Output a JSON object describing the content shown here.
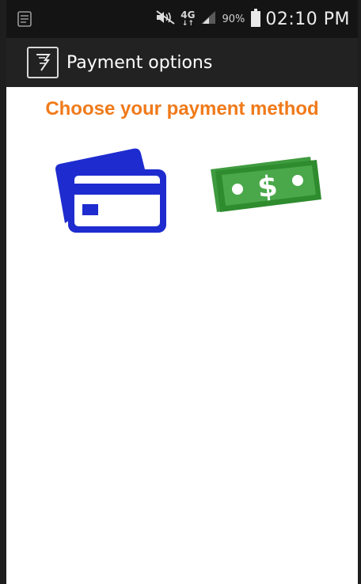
{
  "status_bar": {
    "icons": [
      "notification-icon",
      "mute-icon",
      "network-4g-icon",
      "signal-icon",
      "battery-icon"
    ],
    "network_label_top": "4G",
    "network_label_bottom": "↓↑",
    "battery_percent": "90%",
    "time": "02:10 PM"
  },
  "action_bar": {
    "title": "Payment options",
    "icon": "app-logo-icon"
  },
  "main": {
    "heading": "Choose your payment method",
    "options": [
      {
        "icon": "credit-card-icon",
        "color": "#1e2ccf"
      },
      {
        "icon": "cash-icon",
        "color": "#2e8b2e"
      }
    ]
  },
  "colors": {
    "accent": "#f07a1a",
    "status_bar_bg": "#141414",
    "action_bar_bg": "#222222"
  }
}
